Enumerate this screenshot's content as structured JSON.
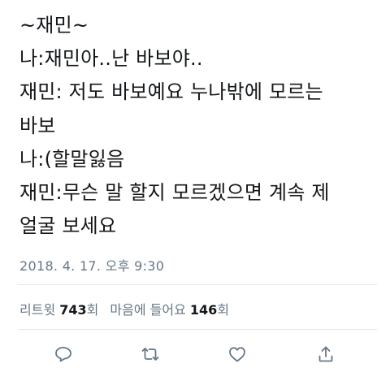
{
  "tweet": {
    "lines": [
      "~재민~",
      "나:재민아..난 바보야..",
      "재민: 저도 바보예요 누나밖에 모르는",
      "바보",
      "나:(할말잃음",
      "재민:무슨 말 할지 모르겠으면 계속 제",
      "얼굴 보세요"
    ],
    "timestamp": "2018. 4. 17. 오후 9:30"
  },
  "stats": {
    "retweet_label": "리트윗",
    "retweet_count": "743",
    "retweet_unit": "회",
    "like_label": "마음에 들어요",
    "like_count": "146",
    "like_unit": "회"
  },
  "actions": {
    "icons": [
      "reply-icon",
      "retweet-icon",
      "like-icon",
      "share-icon"
    ],
    "icon_color": "#657786"
  }
}
